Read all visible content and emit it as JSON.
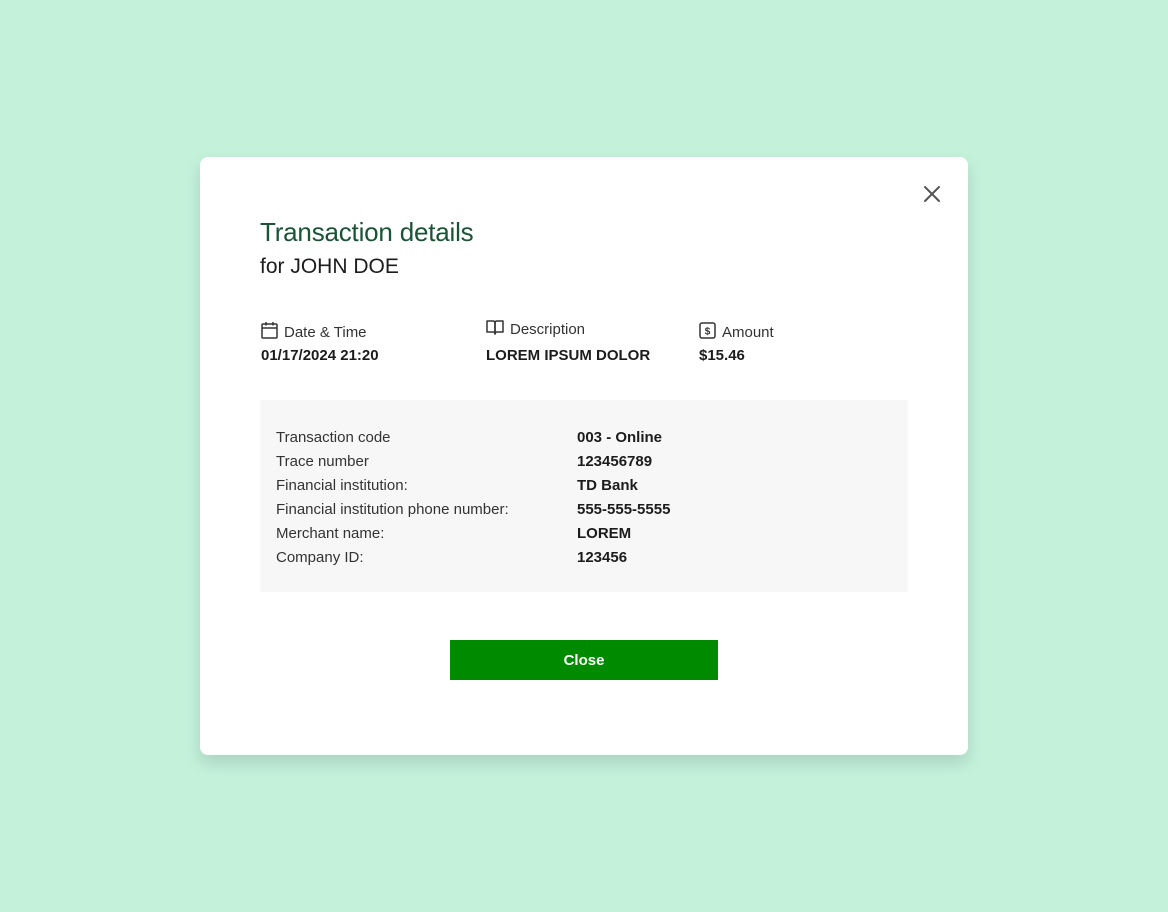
{
  "modal": {
    "title": "Transaction details",
    "subtitle": "for JOHN DOE",
    "close_icon": "close-icon"
  },
  "summary": [
    {
      "icon": "calendar-icon",
      "label": "Date & Time",
      "value": "01/17/2024 21:20"
    },
    {
      "icon": "book-icon",
      "label": "Description",
      "value": "LOREM IPSUM DOLOR"
    },
    {
      "icon": "dollar-icon",
      "label": "Amount",
      "value": "$15.46"
    }
  ],
  "details": [
    {
      "label": "Transaction code",
      "value": "003 - Online"
    },
    {
      "label": "Trace number",
      "value": "123456789"
    },
    {
      "label": "Financial institution:",
      "value": "TD Bank"
    },
    {
      "label": "Financial institution phone number:",
      "value": "555-555-5555"
    },
    {
      "label": "Merchant name:",
      "value": "LOREM"
    },
    {
      "label": "Company ID:",
      "value": "123456"
    }
  ],
  "actions": {
    "close_label": "Close"
  },
  "colors": {
    "background": "#c3f1da",
    "title": "#1a5336",
    "button": "#008a00",
    "details_bg": "#f7f7f7"
  }
}
